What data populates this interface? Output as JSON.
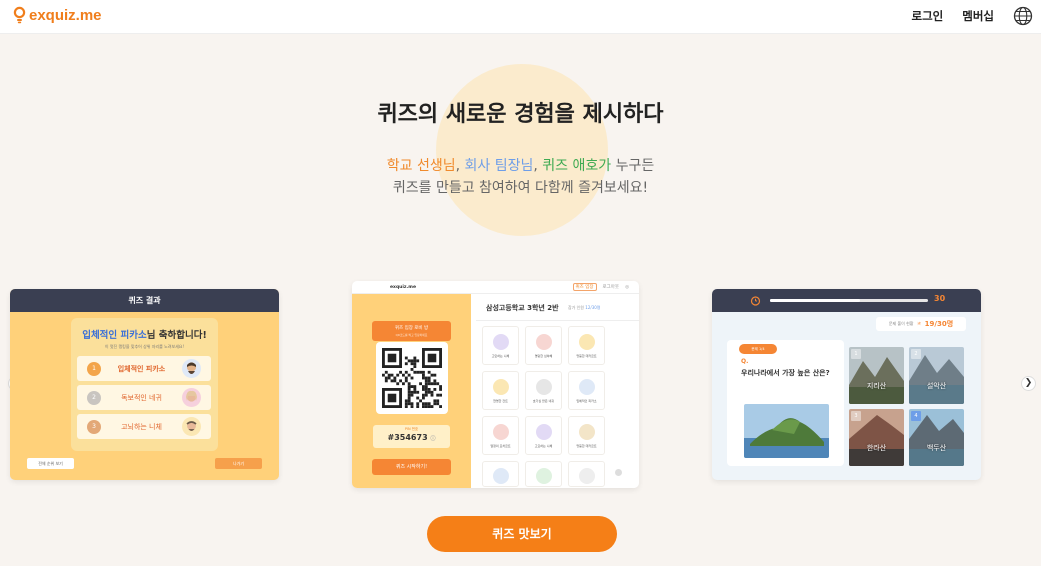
{
  "header": {
    "logo_text": "exquiz.me",
    "nav": {
      "login": "로그인",
      "membership": "멤버십"
    },
    "icons": {
      "logo": "lightbulb-icon",
      "language": "globe-icon"
    },
    "brand_color": "#f07e1c"
  },
  "hero": {
    "title": "퀴즈의 새로운 경험을 제시하다",
    "subtitle_line1": {
      "teacher": "학교 선생님",
      "sep1": ", ",
      "leader": "회사 팀장님",
      "sep2": ", ",
      "fan": "퀴즈 애호가",
      "tail": " 누구든"
    },
    "subtitle_line2": "퀴즈를 만들고 참여하여 다함께 즐겨보세요!"
  },
  "carousel": {
    "prev_icon": "chevron-left-icon",
    "next_icon": "chevron-right-icon",
    "card_result": {
      "header": "퀴즈 결과",
      "congrats_name": "입체적인 피카소",
      "congrats_suffix": "님 축하합니다!",
      "congrats_sub": "이 멋진 랭킹을 맞추어 상위 자리를 노려보세요!",
      "ranks": [
        {
          "rank": "1",
          "name": "입체적인 피카소",
          "highlight": true
        },
        {
          "rank": "2",
          "name": "독보적인 네귀",
          "highlight": false
        },
        {
          "rank": "3",
          "name": "고뇌하는 니체",
          "highlight": false
        }
      ],
      "btn_all": "전체 순위 보기",
      "btn_exit": "나가기"
    },
    "card_lobby": {
      "logo": "exquiz.me",
      "top_badge": "퀴즈 입장",
      "top_link": "로그아웃",
      "join_title": "퀴즈 입장 로비 방",
      "join_hint": "QR코드를 찍고 입장하세요",
      "pin_label": "PIN 번호",
      "pin": "#354673",
      "start_btn": "퀴즈 시작하기!",
      "room_title": "삼성고등학교 3학년 2반",
      "participants_label": "참가 인원",
      "participants": "12/30명",
      "players": [
        "고민하는 니체",
        "명랑한 심하혜",
        "엉뚱한 데카르트",
        "현명한 칸트",
        "호기심 많은 네귀",
        "입체적인 피카소",
        "열정의 모차르트",
        "고요하는 니체",
        "엉뚱한 데카르트",
        "",
        "",
        ""
      ]
    },
    "card_quiz": {
      "timer_count": "30",
      "timer_fraction": 0.57,
      "status_label": "문제 풀이 현황",
      "status_count": "19/30명",
      "question_tag": "문제 1/4",
      "question_mark": "Q.",
      "question": "우리나라에서 가장 높은 산은?",
      "options": [
        {
          "num": "1",
          "label": "지리산",
          "selected": false
        },
        {
          "num": "2",
          "label": "설악산",
          "selected": false
        },
        {
          "num": "3",
          "label": "한라산",
          "selected": false
        },
        {
          "num": "4",
          "label": "백두산",
          "selected": true
        }
      ]
    }
  },
  "cta": {
    "label": "퀴즈 맛보기"
  }
}
